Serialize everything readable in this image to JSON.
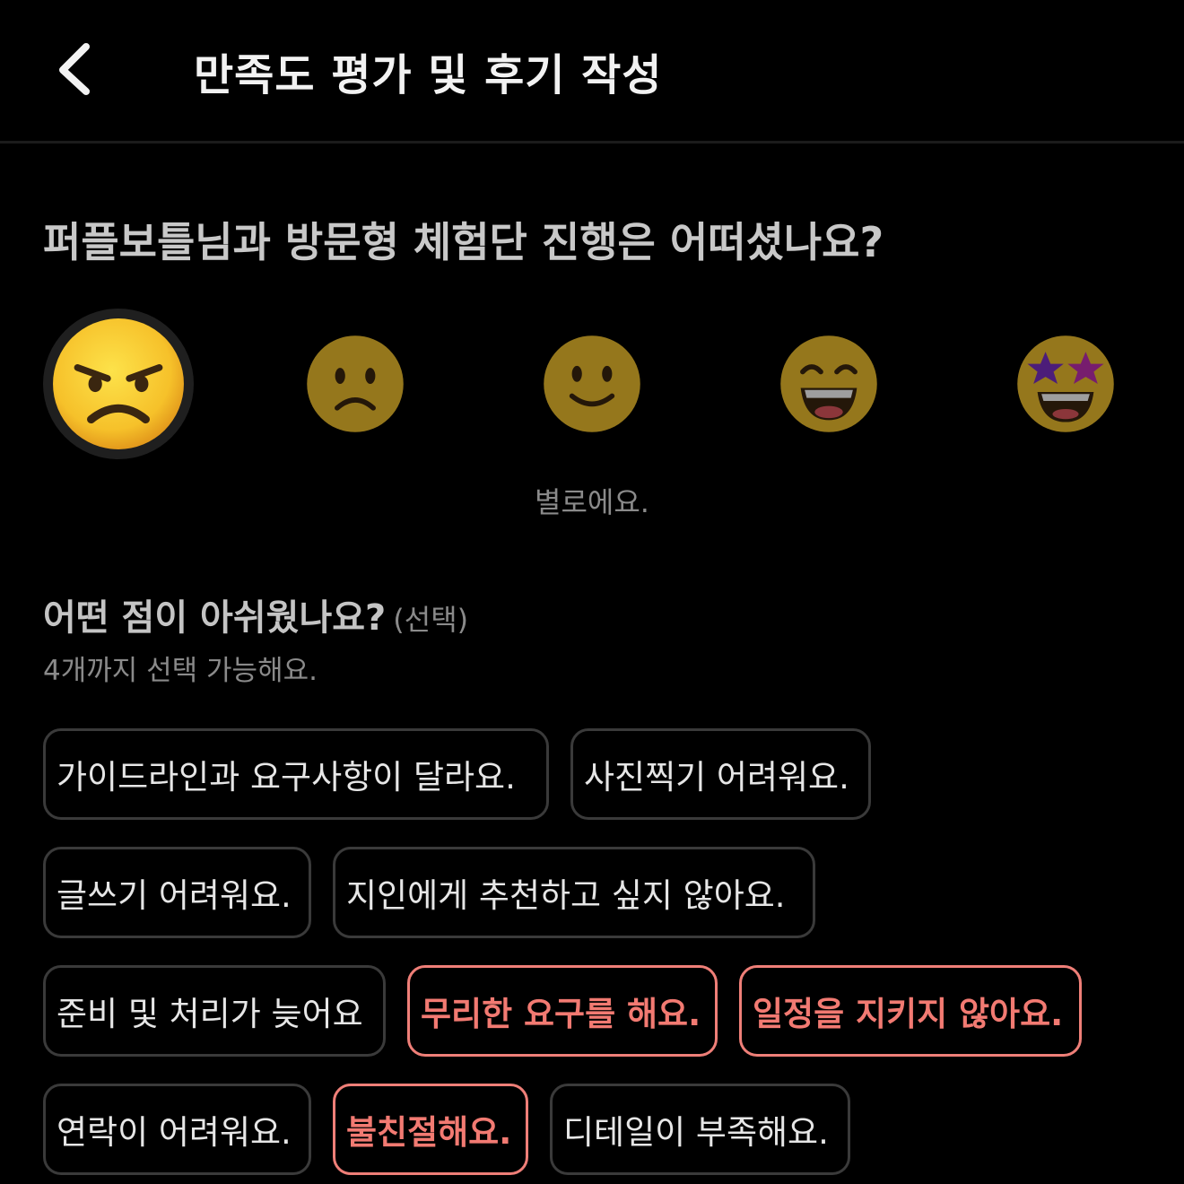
{
  "header": {
    "title": "만족도 평가 및 후기 작성",
    "back_icon": "chevron-left-icon"
  },
  "question": "퍼플보틀님과 방문형 체험단 진행은 어떠셨나요?",
  "ratings": [
    {
      "icon": "angry-face-icon",
      "selected": true
    },
    {
      "icon": "frowning-face-icon",
      "selected": false
    },
    {
      "icon": "slightly-smiling-face-icon",
      "selected": false
    },
    {
      "icon": "grinning-face-icon",
      "selected": false
    },
    {
      "icon": "star-struck-face-icon",
      "selected": false
    }
  ],
  "rating_label": "별로에요.",
  "feedback": {
    "question": "어떤 점이 아쉬웠나요?",
    "optional": "(선택)",
    "hint": "4개까지 선택 가능해요.",
    "chips": [
      {
        "label": "가이드라인과 요구사항이 달라요.",
        "selected": false
      },
      {
        "label": "사진찍기 어려워요.",
        "selected": false
      },
      {
        "label": "글쓰기 어려워요.",
        "selected": false
      },
      {
        "label": "지인에게 추천하고 싶지 않아요.",
        "selected": false
      },
      {
        "label": "준비 및 처리가 늦어요",
        "selected": false
      },
      {
        "label": "무리한 요구를 해요.",
        "selected": true
      },
      {
        "label": "일정을 지키지 않아요.",
        "selected": true
      },
      {
        "label": "연락이 어려워요.",
        "selected": false
      },
      {
        "label": "불친절해요.",
        "selected": true
      },
      {
        "label": "디테일이 부족해요.",
        "selected": false
      }
    ]
  },
  "colors": {
    "accent": "#f27a72",
    "chip_border": "#3a3a3a",
    "background": "#000000"
  }
}
